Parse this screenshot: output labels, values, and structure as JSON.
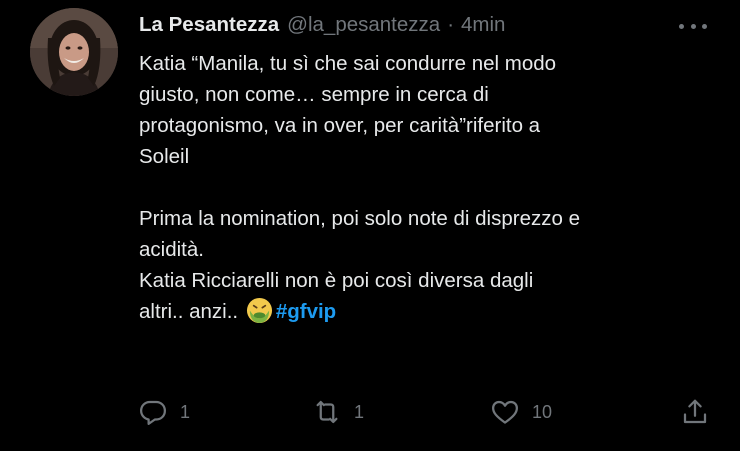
{
  "user": {
    "display_name": "La Pesantezza",
    "handle": "@la_pesantezza",
    "separator": "·",
    "time": "4min"
  },
  "tweet": {
    "lines": [
      "Katia “Manila, tu sì che sai condurre nel modo",
      "giusto, non come… sempre in cerca di",
      "protagonismo, va in over, per carità”riferito a",
      "Soleil",
      "Prima la nomination, poi solo note di disprezzo e",
      "acidità.",
      "Katia Ricciarelli non è poi così diversa dagli",
      "altri.. anzi.."
    ],
    "emoji": "nauseated-face-emoji",
    "hashtag": "#gfvip"
  },
  "actions": {
    "reply_count": "1",
    "retweet_count": "1",
    "like_count": "10",
    "share_count": ""
  },
  "colors": {
    "background": "#000000",
    "text": "#e7e9ea",
    "muted": "#71767b",
    "accent": "#1d9bf0"
  }
}
